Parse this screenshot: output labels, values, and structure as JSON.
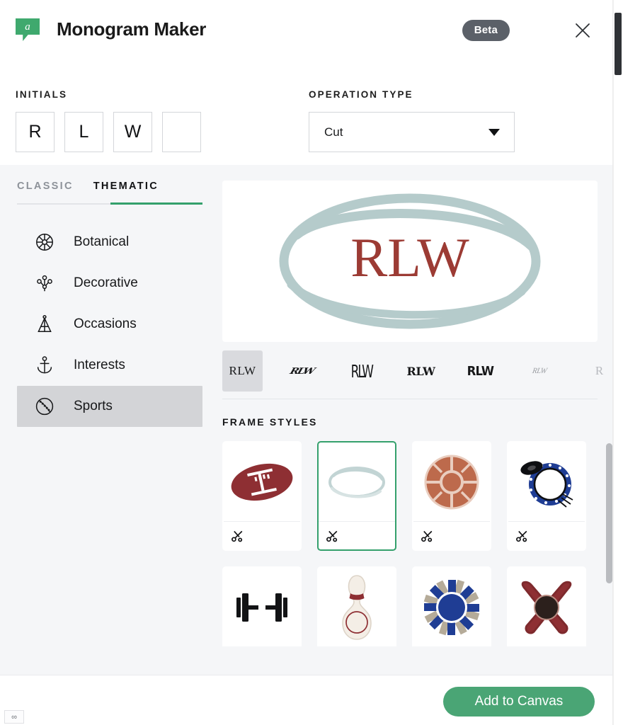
{
  "header": {
    "logo_icon": "avery-logo-icon",
    "logo_letter": "a",
    "title": "Monogram Maker",
    "badge": "Beta",
    "close_icon": "close-icon"
  },
  "form": {
    "initials_label": "INITIALS",
    "initials": [
      "R",
      "L",
      "W",
      ""
    ],
    "operation_label": "OPERATION TYPE",
    "operation_value": "Cut",
    "operation_options": [
      "Cut"
    ]
  },
  "sidebar": {
    "tabs": [
      {
        "label": "CLASSIC",
        "active": false
      },
      {
        "label": "THEMATIC",
        "active": true
      }
    ],
    "items": [
      {
        "label": "Botanical",
        "icon": "flower-icon",
        "active": false
      },
      {
        "label": "Decorative",
        "icon": "flourish-icon",
        "active": false
      },
      {
        "label": "Occasions",
        "icon": "party-hat-icon",
        "active": false
      },
      {
        "label": "Interests",
        "icon": "anchor-icon",
        "active": false
      },
      {
        "label": "Sports",
        "icon": "baseball-icon",
        "active": true
      }
    ]
  },
  "preview": {
    "monogram_text": "RLW",
    "frame": "oval-sketch-frame",
    "text_color": "#9c3b34",
    "frame_color": "#b5cbcb",
    "next_icon": "chevron-right-icon"
  },
  "font_styles": [
    {
      "name": "serif-roman",
      "label": "RLW",
      "selected": true
    },
    {
      "name": "script-brush",
      "label": "RLW",
      "selected": false
    },
    {
      "name": "hand-drawn",
      "label": "RLW",
      "selected": false
    },
    {
      "name": "slab-bold",
      "label": "RLW",
      "selected": false
    },
    {
      "name": "condensed-black",
      "label": "RLW",
      "selected": false
    },
    {
      "name": "calligraphy",
      "label": "RLW",
      "selected": false
    },
    {
      "name": "partial-next",
      "label": "R",
      "selected": false
    }
  ],
  "frames": {
    "title": "FRAME STYLES",
    "cut_icon": "scissors-icon",
    "items": [
      {
        "name": "football-frame",
        "selected": false
      },
      {
        "name": "oval-sketch-frame",
        "selected": true
      },
      {
        "name": "basketball-frame",
        "selected": false
      },
      {
        "name": "hockey-puck-frame",
        "selected": false
      },
      {
        "name": "dumbbell-frame",
        "selected": false
      },
      {
        "name": "bowling-pin-frame",
        "selected": false
      },
      {
        "name": "starburst-frame",
        "selected": false
      },
      {
        "name": "crossed-bats-frame",
        "selected": false
      }
    ]
  },
  "footer": {
    "add_label": "Add to Canvas",
    "corner_icon": "infinity-icon",
    "corner_label": "∞"
  },
  "colors": {
    "accent_green": "#34a06c",
    "button_green": "#4aa575",
    "badge_gray": "#5b6068",
    "panel_bg": "#f5f6f8",
    "monogram_red": "#9c3b34",
    "frame_teal": "#b5cbcb"
  }
}
